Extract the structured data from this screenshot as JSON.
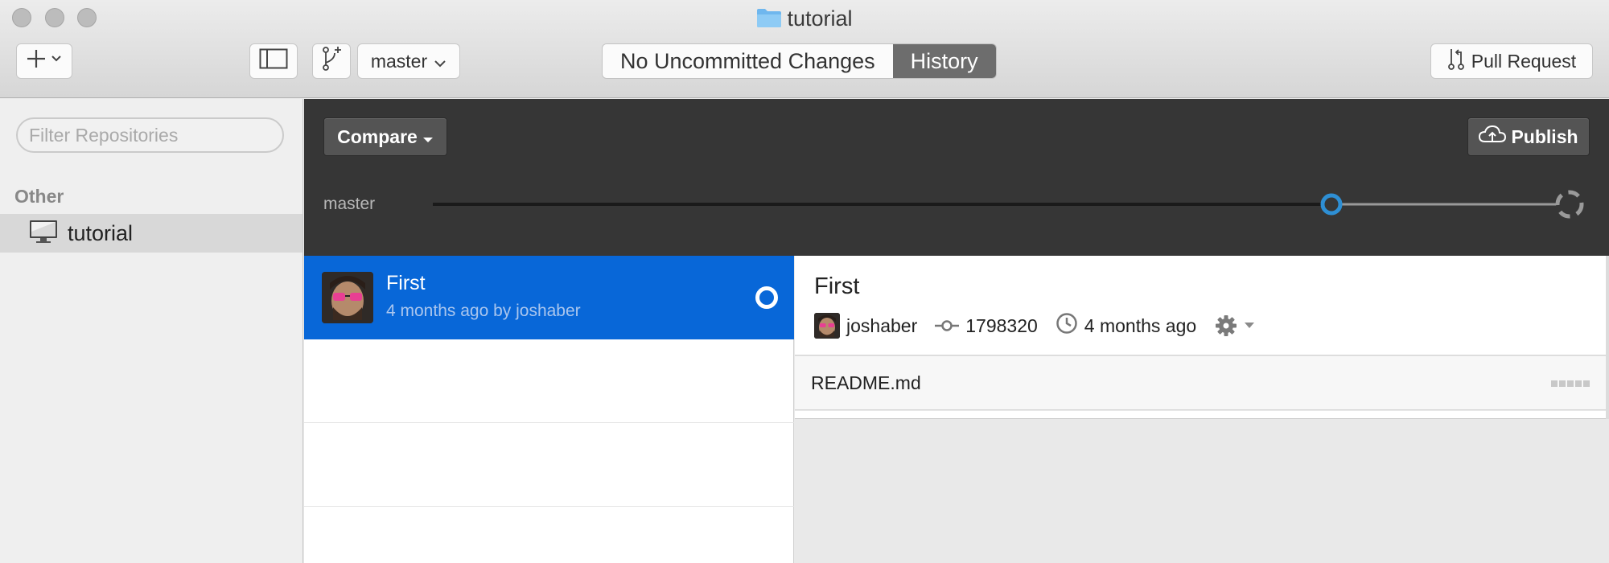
{
  "window": {
    "title": "tutorial"
  },
  "toolbar": {
    "add_icon": "plus-icon",
    "branch": "master",
    "segments": {
      "changes": "No Uncommitted Changes",
      "history": "History"
    },
    "pull_request": "Pull Request"
  },
  "sidebar": {
    "filter_placeholder": "Filter Repositories",
    "section": "Other",
    "repos": [
      {
        "name": "tutorial",
        "icon": "monitor-icon"
      }
    ]
  },
  "header": {
    "compare": "Compare",
    "publish": "Publish",
    "branch_label": "master"
  },
  "commits": [
    {
      "title": "First",
      "meta": "4 months ago by joshaber"
    }
  ],
  "detail": {
    "title": "First",
    "author": "joshaber",
    "sha": "1798320",
    "time": "4 months ago",
    "files": [
      {
        "name": "README.md"
      }
    ]
  },
  "colors": {
    "selection_blue": "#0867d8",
    "timeline_blue": "#2e8fd4",
    "dark_header": "#363636"
  }
}
